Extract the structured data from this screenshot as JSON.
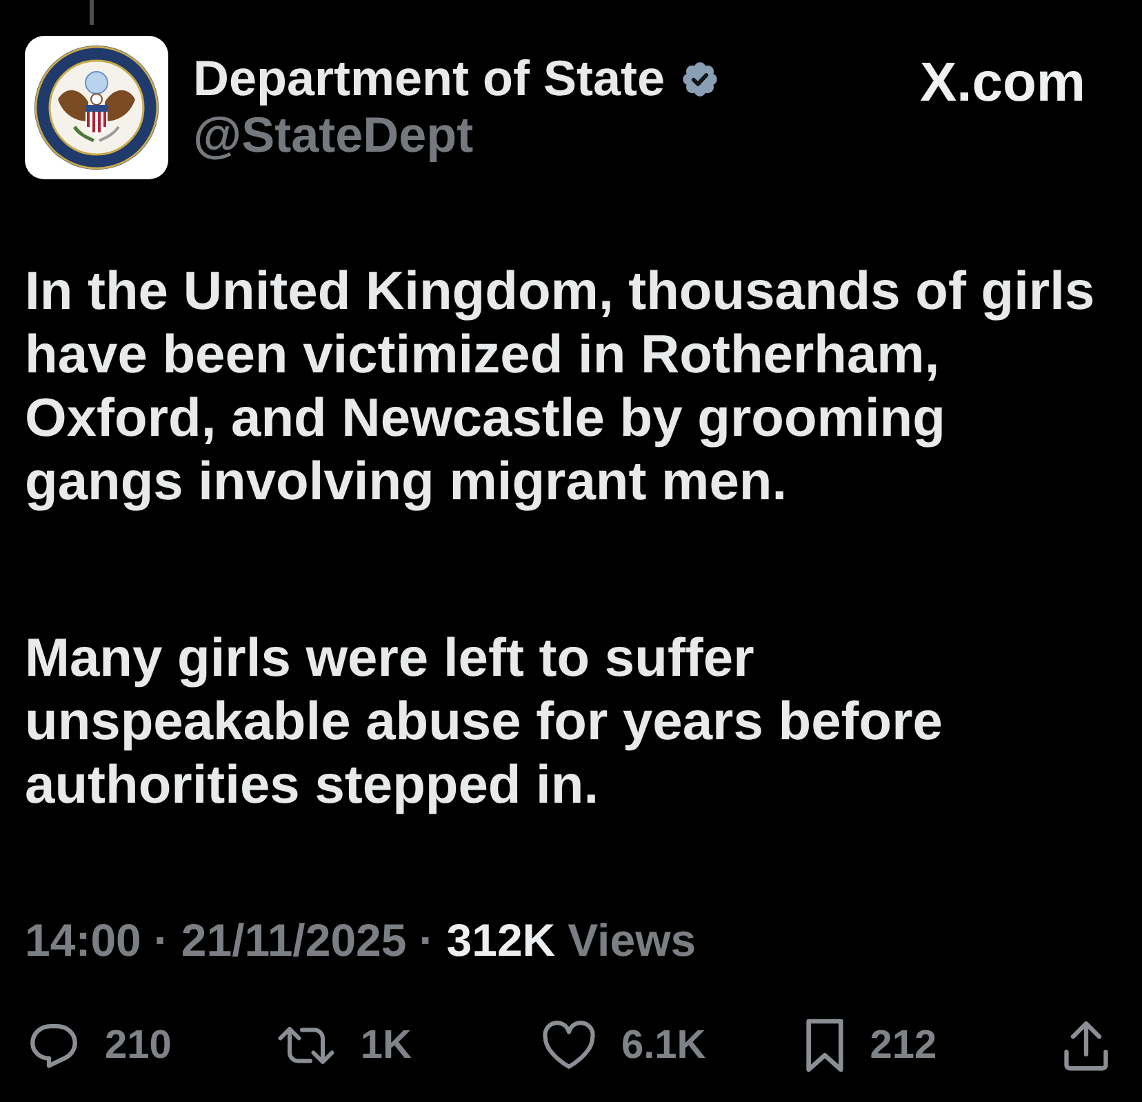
{
  "author": {
    "name": "Department of State",
    "verified": true,
    "handle": "@StateDept"
  },
  "source": "X.com",
  "paragraphs": [
    "In the United Kingdom, thousands of girls\nhave been victimized in Rotherham,\nOxford, and Newcastle by grooming\ngangs involving migrant men.",
    "Many girls were left to suffer\nunspeakable abuse for years before\nauthorities stepped in."
  ],
  "meta": [
    {
      "kind": "time",
      "text": "14:00"
    },
    {
      "kind": "separator",
      "text": "·"
    },
    {
      "kind": "date",
      "text": "21/11/2025"
    },
    {
      "kind": "separator",
      "text": "·"
    },
    {
      "kind": "views_count",
      "text": "312K"
    },
    {
      "kind": "views_label",
      "text": "Views"
    }
  ],
  "actions": [
    {
      "kind": "reply",
      "count": "210"
    },
    {
      "kind": "repost",
      "count": "1K"
    },
    {
      "kind": "like",
      "count": "6.1K"
    },
    {
      "kind": "bookmark",
      "count": "212"
    },
    {
      "kind": "share"
    }
  ]
}
